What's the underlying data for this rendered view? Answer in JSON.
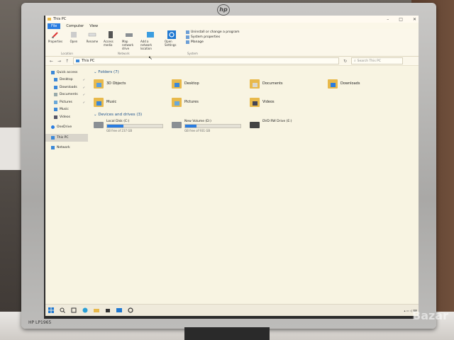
{
  "explorer": {
    "title": "This PC",
    "tabs": [
      "File",
      "Computer",
      "View"
    ],
    "ribbon_buttons": [
      "Properties",
      "Open",
      "Rename",
      "Access media",
      "Map network drive",
      "Add a network location",
      "Open Settings"
    ],
    "ribbon_list": [
      "Uninstall or change a program",
      "System properties",
      "Manage"
    ],
    "ribbon_groups": [
      "Location",
      "Network",
      "System"
    ],
    "address": "This PC",
    "search_placeholder": "Search This PC",
    "nav": [
      "Quick access",
      "Desktop",
      "Downloads",
      "Documents",
      "Pictures",
      "Music",
      "Videos",
      "OneDrive",
      "This PC",
      "Network"
    ],
    "folders_header": "Folders (7)",
    "folders": [
      "3D Objects",
      "Desktop",
      "Documents",
      "Downloads",
      "Music",
      "Pictures",
      "Videos"
    ],
    "drives_header": "Devices and drives (3)",
    "drives": [
      {
        "name": "Local Disk (C:)",
        "free": "GB free of 237 GB",
        "used_fraction": 0.3
      },
      {
        "name": "New Volume (D:)",
        "free": "GB free of 931 GB",
        "used_fraction": 0.2
      },
      {
        "name": "DVD RW Drive (E:)",
        "free": "",
        "used_fraction": 0
      }
    ]
  },
  "monitor": {
    "model": "HP LP1965"
  },
  "watermark": "Bazar",
  "colors": {
    "accent": "#2a7de1",
    "folder": "#e8b94b",
    "window_bg": "#f8f4e2"
  }
}
